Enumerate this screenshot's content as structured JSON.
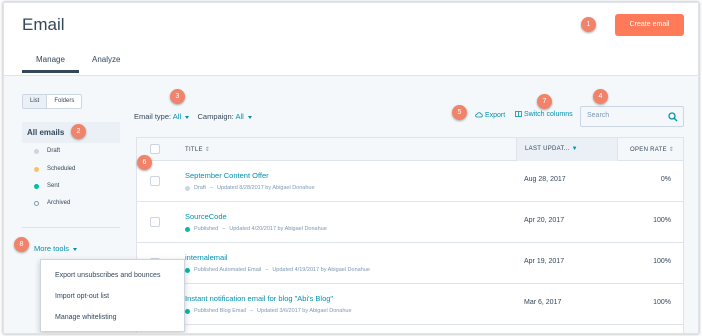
{
  "header": {
    "title": "Email",
    "create_button": "Create email",
    "tabs": [
      {
        "label": "Manage"
      },
      {
        "label": "Analyze"
      }
    ]
  },
  "badges": [
    "1",
    "2",
    "3",
    "4",
    "5",
    "6",
    "7",
    "8"
  ],
  "sidebar": {
    "toggle": [
      "List",
      "Folders"
    ],
    "all_emails": "All emails",
    "statuses": [
      {
        "label": "Draft",
        "color": "#cbd6e2"
      },
      {
        "label": "Scheduled",
        "color": "#f5c26b"
      },
      {
        "label": "Sent",
        "color": "#00bda5"
      },
      {
        "label": "Archived",
        "color": "#ffffff"
      }
    ],
    "more_tools": "More tools"
  },
  "more_tools_menu": [
    "Export unsubscribes and bounces",
    "Import opt-out list",
    "Manage whitelisting"
  ],
  "filters": {
    "email_type_label": "Email type:",
    "email_type_value": "All",
    "campaign_label": "Campaign:",
    "campaign_value": "All"
  },
  "toolbar": {
    "export": "Export",
    "switch_columns": "Switch columns",
    "search_placeholder": "Search"
  },
  "table": {
    "columns": [
      "TITLE",
      "LAST UPDAT...",
      "OPEN RATE"
    ],
    "rows": [
      {
        "title": "September Content Offer",
        "status": "Draft",
        "status_color": "#cbd6e2",
        "updated": "Updated 8/28/2017 by Abigael Donahue",
        "date": "Aug 28, 2017",
        "rate": "0%"
      },
      {
        "title": "SourceCode",
        "status": "Published",
        "status_color": "#00bda5",
        "updated": "Updated 4/20/2017 by Abigael Donahue",
        "date": "Apr 20, 2017",
        "rate": "100%"
      },
      {
        "title": "internalemail",
        "status": "Published Automated Email",
        "status_color": "#00bda5",
        "updated": "Updated 4/19/2017 by Abigael Donahue",
        "date": "Apr 19, 2017",
        "rate": "100%"
      },
      {
        "title": "Instant notification email for blog \"Abi's Blog\"",
        "status": "Published Blog Email",
        "status_color": "#00bda5",
        "updated": "Updated 3/6/2017 by Abigael Donahue",
        "date": "Mar 6, 2017",
        "rate": "100%"
      }
    ]
  }
}
